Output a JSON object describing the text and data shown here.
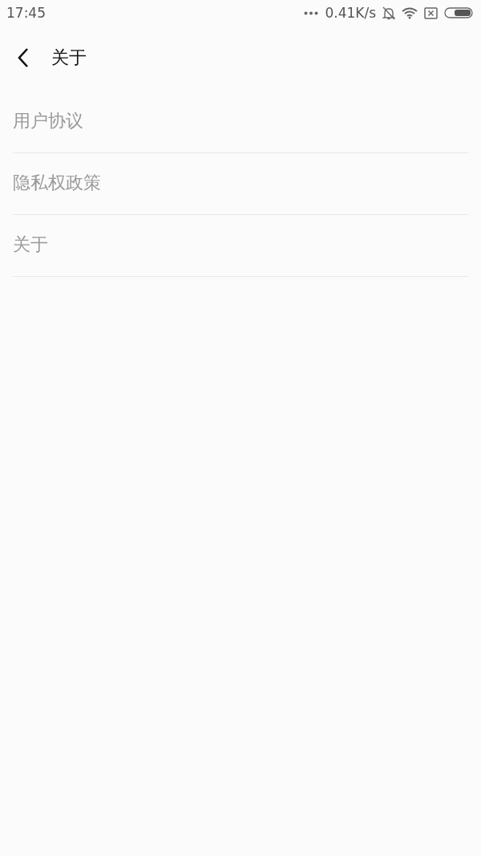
{
  "status_bar": {
    "time": "17:45",
    "network_speed": "0.41K/s"
  },
  "header": {
    "title": "关于"
  },
  "menu_items": [
    {
      "label": "用户协议"
    },
    {
      "label": "隐私权政策"
    },
    {
      "label": "关于"
    }
  ]
}
